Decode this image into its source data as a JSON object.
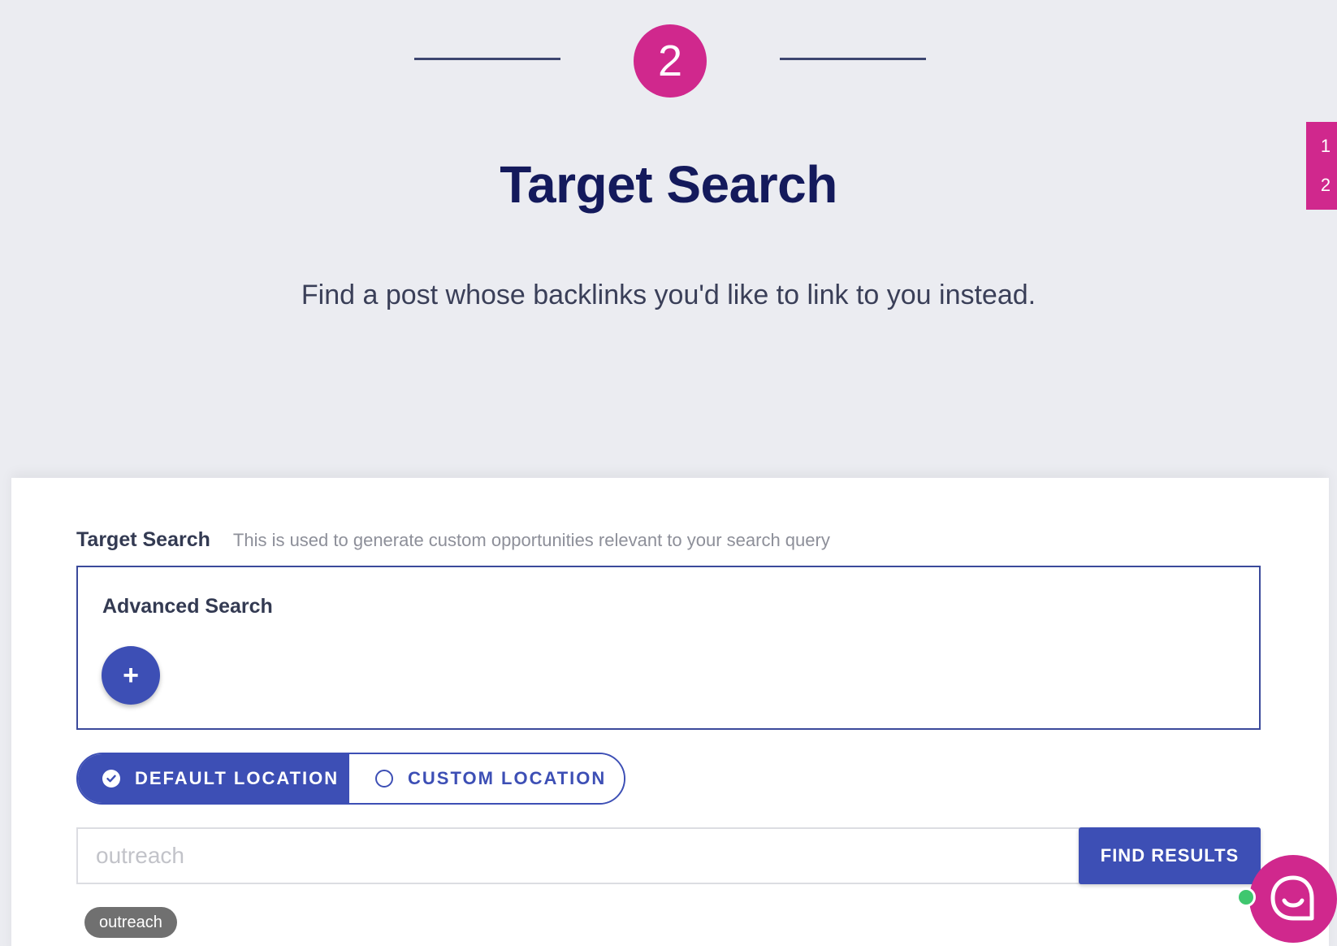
{
  "stepper": {
    "current_step": "2"
  },
  "side_nav": {
    "items": [
      "1",
      "2"
    ]
  },
  "header": {
    "title": "Target Search",
    "subtitle": "Find a post whose backlinks you'd like to link to you instead."
  },
  "form": {
    "label": "Target Search",
    "help_text": "This is used to generate custom opportunities relevant to your search query",
    "advanced": {
      "title": "Advanced Search",
      "add_symbol": "+"
    },
    "location": {
      "default_label": "DEFAULT LOCATION",
      "custom_label": "CUSTOM LOCATION",
      "selected": "default"
    },
    "search": {
      "placeholder": "outreach",
      "value": "",
      "button_label": "FIND RESULTS"
    },
    "tags": [
      "outreach"
    ]
  },
  "colors": {
    "accent": "#d0288d",
    "primary": "#3d4fb5",
    "title": "#141a5c",
    "online": "#3fc76f"
  },
  "icons": {
    "location_default": "check-circle-icon",
    "location_custom": "radio-empty-icon",
    "chat": "chat-bubble-icon"
  }
}
